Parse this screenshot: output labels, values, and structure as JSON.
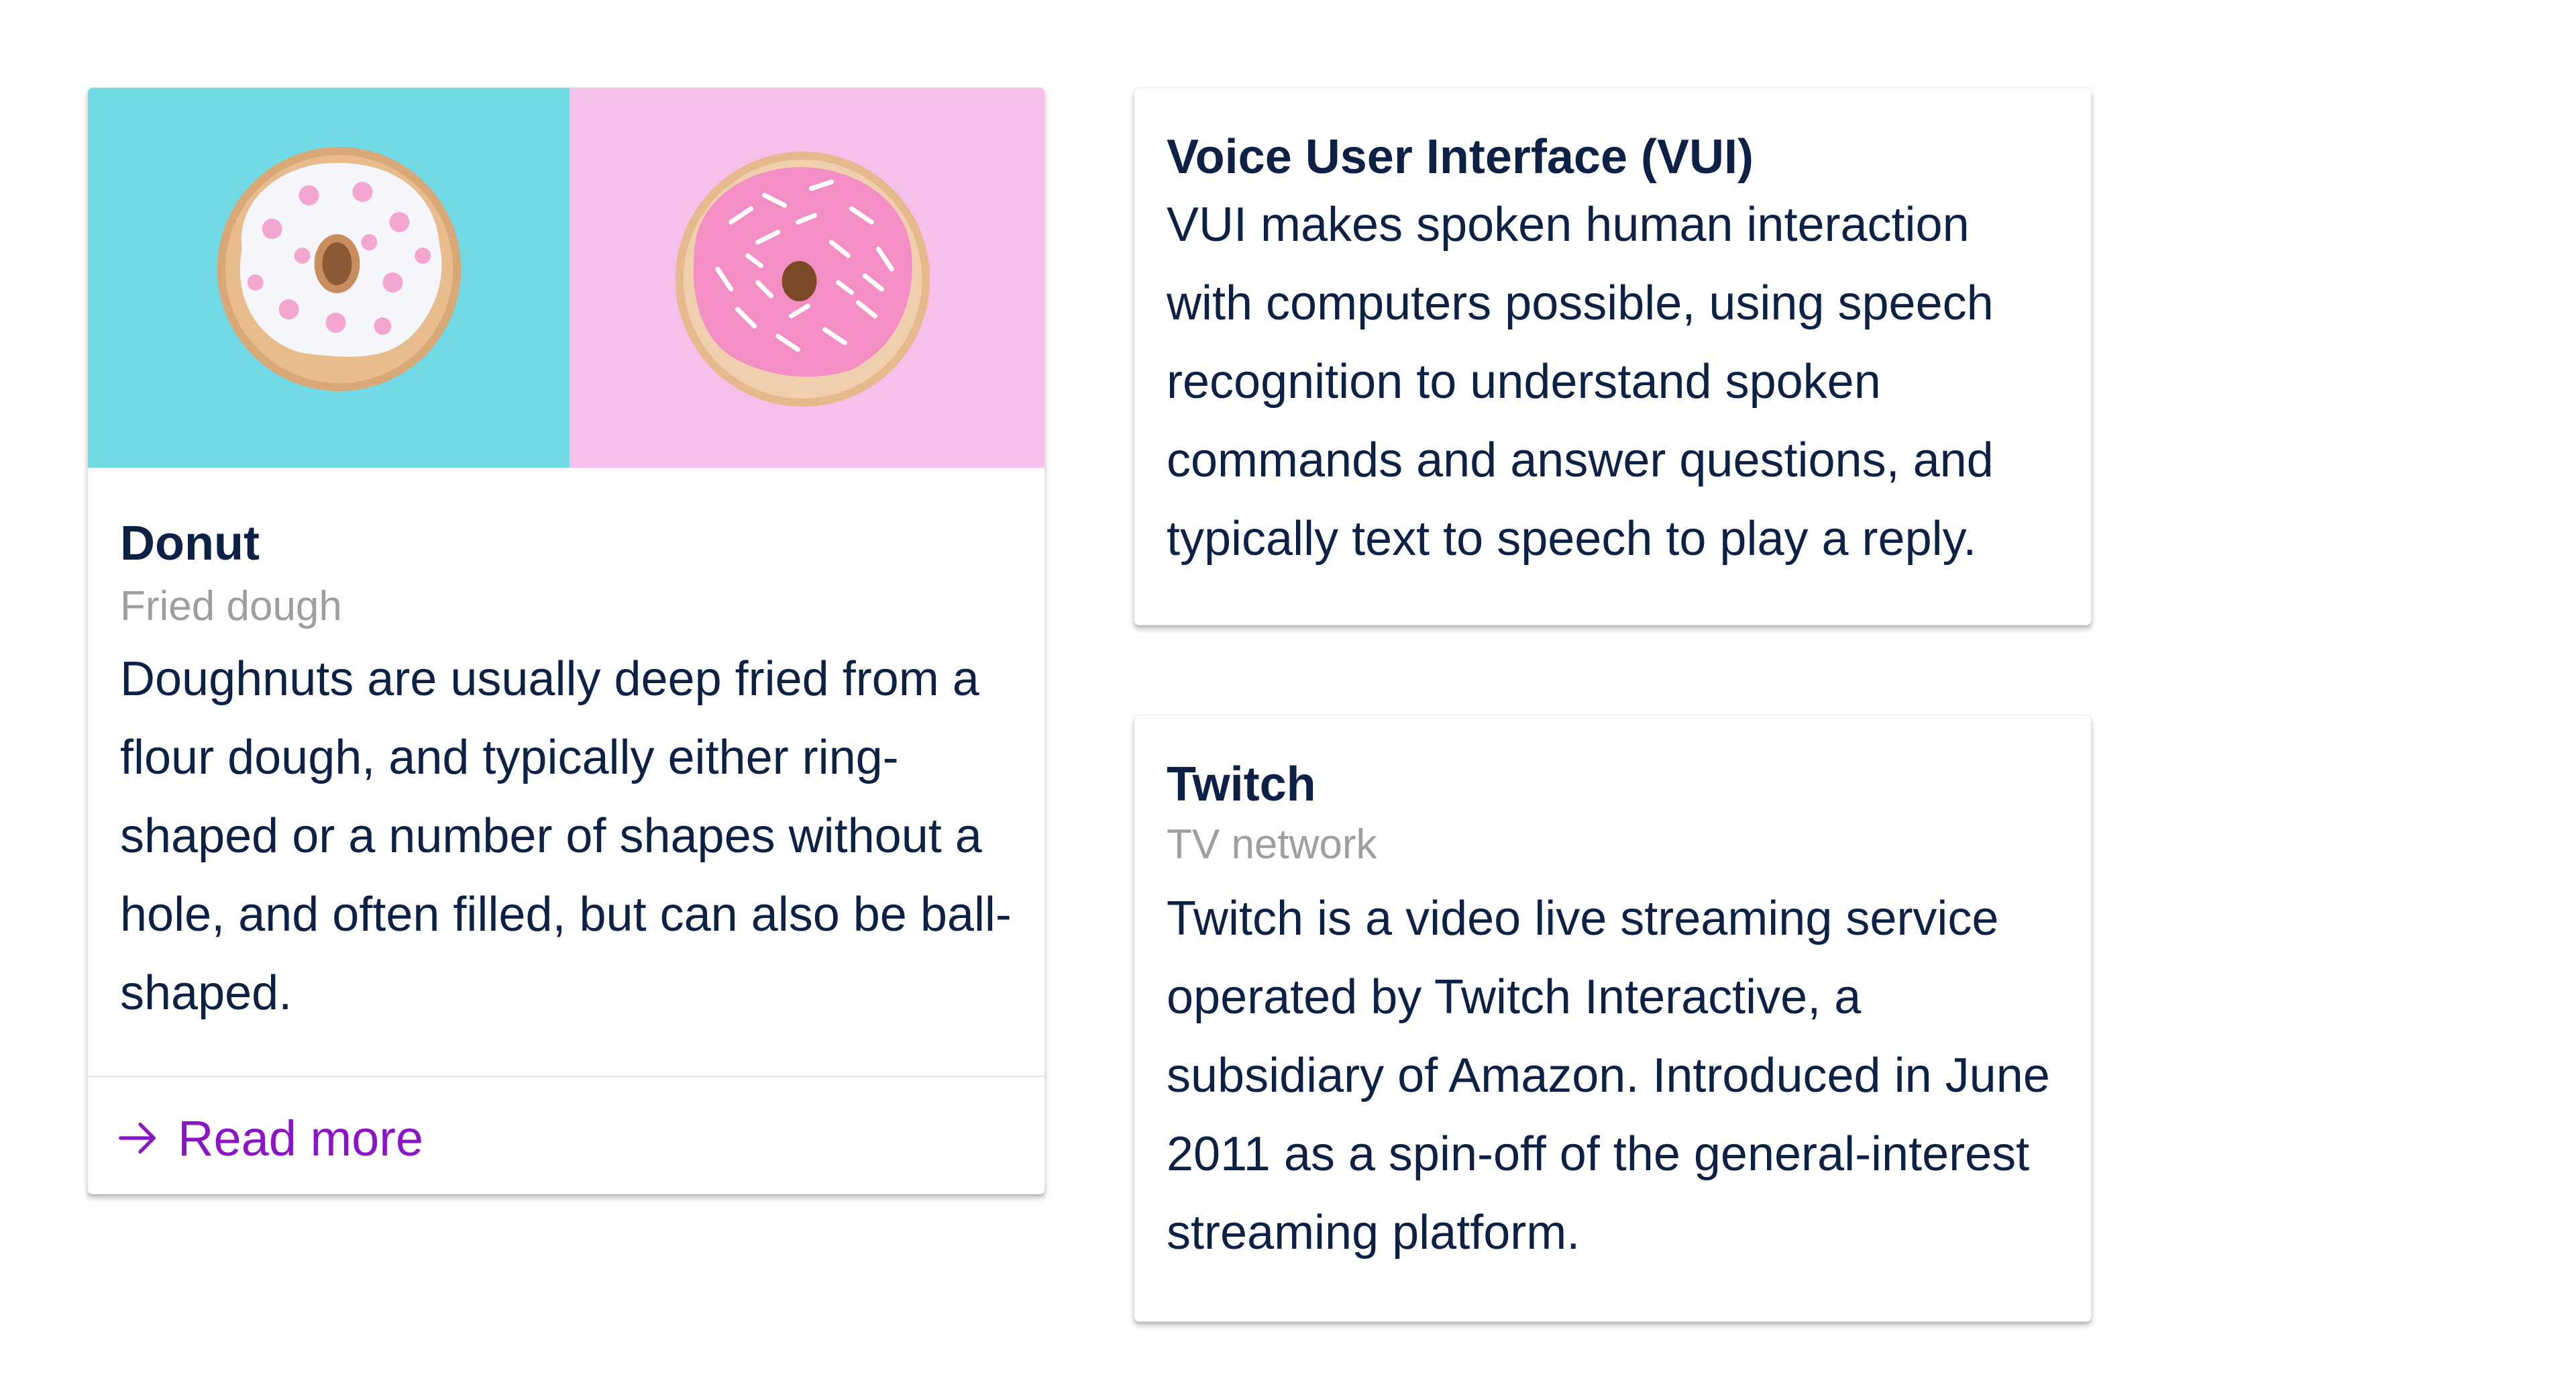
{
  "cards": {
    "donut": {
      "title": "Donut",
      "subtitle": "Fried dough",
      "text": "Doughnuts are usually deep fried from a flour dough, and typically either ring-shaped or a number of shapes without a hole, and often filled, but can also be ball-shaped.",
      "action_label": "Read more",
      "action_icon": "arrow-right-icon",
      "media_colors": {
        "left": "#72d9e6",
        "right": "#f7c0ea"
      }
    },
    "vui": {
      "title": "Voice User Interface (VUI)",
      "text": "VUI makes spoken human interaction with computers possible, using speech recognition to understand spoken commands and answer questions, and typically text to speech to play a reply."
    },
    "twitch": {
      "title": "Twitch",
      "subtitle": "TV network",
      "text": "Twitch is a video live streaming service operated by Twitch Interactive, a subsidiary of Amazon. Introduced in June 2011 as a spin-off of the general-interest streaming platform."
    }
  },
  "colors": {
    "text": "#0d2147",
    "subtitle": "#9e9e9e",
    "link": "#8a14c6"
  }
}
